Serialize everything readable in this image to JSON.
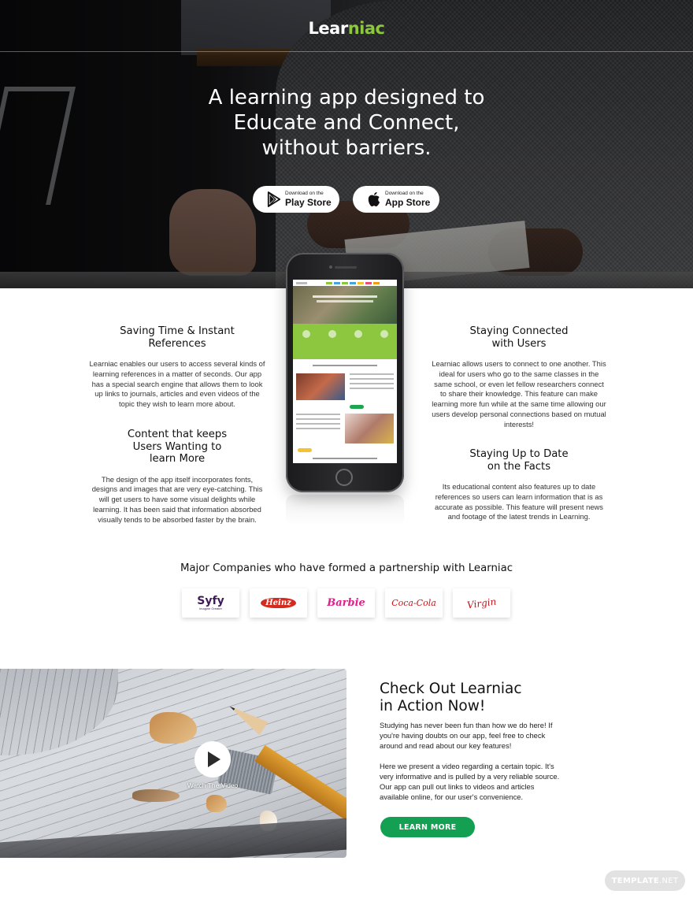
{
  "brand": {
    "logo_part1": "Lear",
    "logo_part2": "niac",
    "accent_color": "#8dc63f",
    "button_color": "#13a052"
  },
  "hero": {
    "title_lines": [
      "A learning app designed to",
      "Educate and Connect,",
      "without barriers."
    ],
    "play_store": {
      "icon": "google-play-icon",
      "small": "Download on the",
      "big": "Play Store"
    },
    "app_store": {
      "icon": "apple-icon",
      "small": "Download on the",
      "big": "App Store"
    }
  },
  "features": [
    {
      "title_lines": [
        "Saving Time & Instant",
        "References"
      ],
      "text": "Learniac enables our users to access several kinds of learning references in a matter of seconds. Our app has a special search engine that allows them to look up links to journals, articles and even videos of the topic they wish to learn more about."
    },
    {
      "title_lines": [
        "Content that keeps",
        "Users Wanting to",
        "learn More"
      ],
      "text": "The design of the app itself incorporates fonts, designs and images that are very eye-catching. This will get users to have some visual delights while learning. It has been said that information absorbed visually tends to be absorbed faster by the brain."
    },
    {
      "title_lines": [
        "Staying Connected",
        "with Users"
      ],
      "text": "Learniac allows users to connect to one another. This ideal for users who go to the same classes in the same school, or even let fellow researchers connect to share their knowledge. This feature can make learning more fun while at the same time allowing our users develop personal connections based on mutual interests!"
    },
    {
      "title_lines": [
        "Staying Up to Date",
        "on the Facts"
      ],
      "text": "Its educational content also features up to date references so users can learn information that is as accurate as possible. This feature will present news and footage of the latest trends in Learning."
    }
  ],
  "partners": {
    "title": "Major Companies who have formed a partnership with Learniac",
    "logos": [
      {
        "name": "Syfy",
        "sub": "Imagine Greater"
      },
      {
        "name": "Heinz"
      },
      {
        "name": "Barbie"
      },
      {
        "name": "Coca-Cola"
      },
      {
        "name": "Virgin"
      }
    ]
  },
  "video": {
    "watch_label": "Watch The Video",
    "play_icon": "play-icon"
  },
  "cta": {
    "title_lines": [
      "Check Out Learniac",
      "in Action Now!"
    ],
    "paragraph1": "Studying has never been fun than how we do here! If you're having doubts on our app, feel free to check around and read about our key features!",
    "paragraph2": "Here we present a video regarding a certain topic. It's very informative and is pulled by a very reliable source. Our app can pull out links to videos and articles available online, for our user's convenience.",
    "button_label": "LEARN MORE"
  },
  "watermark": {
    "part1": "TEMPLATE",
    "part2": ".NET"
  }
}
